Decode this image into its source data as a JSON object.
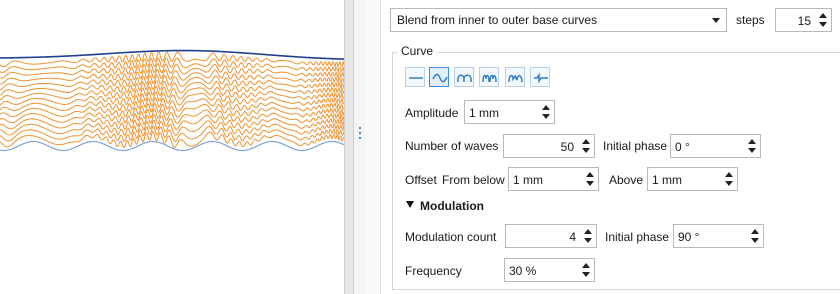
{
  "blend": {
    "mode": "Blend from inner to outer base curves",
    "steps_label": "steps",
    "steps_value": "15"
  },
  "curve": {
    "title": "Curve",
    "shape_icons": [
      "straight-line-icon",
      "sine-wave-icon",
      "arch-wave-icon",
      "double-arch-wave-icon",
      "zigzag-arch-wave-icon",
      "step-wave-icon"
    ],
    "amplitude_label": "Amplitude",
    "amplitude_value": "1 mm",
    "waves_label": "Number of waves",
    "waves_value": "50",
    "phase_label": "Initial phase",
    "phase_value": "0 °",
    "offset_label": "Offset",
    "from_below_label": "From below",
    "from_below_value": "1 mm",
    "above_label": "Above",
    "above_value": "1 mm"
  },
  "modulation": {
    "title": "Modulation",
    "count_label": "Modulation count",
    "count_value": "4",
    "phase_label": "Initial phase",
    "phase_value": "90 °",
    "frequency_label": "Frequency",
    "frequency_value": "30 %"
  },
  "colors": {
    "curve_orange": "#f0922e",
    "base_blue": "#1f3f8f",
    "lower_blue": "#7ea3d8",
    "accent": "#3c8cd8"
  }
}
